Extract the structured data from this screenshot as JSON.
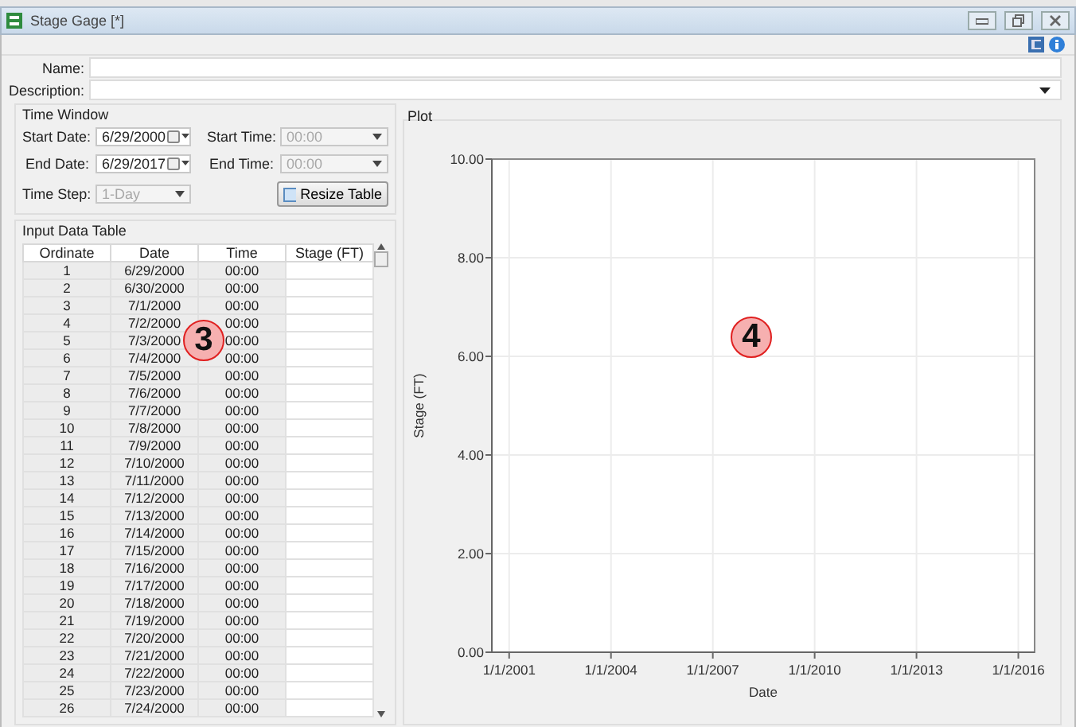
{
  "window": {
    "title": "Stage Gage [*]"
  },
  "fields": {
    "name": {
      "label": "Name:"
    },
    "description": {
      "label": "Description:"
    }
  },
  "time_window": {
    "title": "Time Window",
    "start_date": {
      "label": "Start Date:",
      "value": "6/29/2000"
    },
    "end_date": {
      "label": "End Date:",
      "value": "6/29/2017"
    },
    "time_step": {
      "label": "Time Step:",
      "value": "1-Day",
      "disabled": true
    },
    "start_time": {
      "label": "Start Time:",
      "value": "00:00",
      "disabled": true
    },
    "end_time": {
      "label": "End Time:",
      "value": "00:00",
      "disabled": true
    },
    "resize_button": {
      "label": "Resize Table"
    }
  },
  "table": {
    "title": "Input Data Table",
    "columns": [
      "Ordinate",
      "Date",
      "Time",
      "Stage (FT)"
    ],
    "rows": [
      [
        "1",
        "6/29/2000",
        "00:00"
      ],
      [
        "2",
        "6/30/2000",
        "00:00"
      ],
      [
        "3",
        "7/1/2000",
        "00:00"
      ],
      [
        "4",
        "7/2/2000",
        "00:00"
      ],
      [
        "5",
        "7/3/2000",
        "00:00"
      ],
      [
        "6",
        "7/4/2000",
        "00:00"
      ],
      [
        "7",
        "7/5/2000",
        "00:00"
      ],
      [
        "8",
        "7/6/2000",
        "00:00"
      ],
      [
        "9",
        "7/7/2000",
        "00:00"
      ],
      [
        "10",
        "7/8/2000",
        "00:00"
      ],
      [
        "11",
        "7/9/2000",
        "00:00"
      ],
      [
        "12",
        "7/10/2000",
        "00:00"
      ],
      [
        "13",
        "7/11/2000",
        "00:00"
      ],
      [
        "14",
        "7/12/2000",
        "00:00"
      ],
      [
        "15",
        "7/13/2000",
        "00:00"
      ],
      [
        "16",
        "7/14/2000",
        "00:00"
      ],
      [
        "17",
        "7/15/2000",
        "00:00"
      ],
      [
        "18",
        "7/16/2000",
        "00:00"
      ],
      [
        "19",
        "7/17/2000",
        "00:00"
      ],
      [
        "20",
        "7/18/2000",
        "00:00"
      ],
      [
        "21",
        "7/19/2000",
        "00:00"
      ],
      [
        "22",
        "7/20/2000",
        "00:00"
      ],
      [
        "23",
        "7/21/2000",
        "00:00"
      ],
      [
        "24",
        "7/22/2000",
        "00:00"
      ],
      [
        "25",
        "7/23/2000",
        "00:00"
      ],
      [
        "26",
        "7/24/2000",
        "00:00"
      ]
    ]
  },
  "plot": {
    "title": "Plot",
    "chart_data": {
      "type": "line",
      "grid": true,
      "xlabel": "Date",
      "ylabel": "Stage (FT)",
      "ylim": [
        0,
        10
      ],
      "categories": [
        "1/1/2001",
        "1/1/2004",
        "1/1/2007",
        "1/1/2010",
        "1/1/2013",
        "1/1/2016"
      ],
      "yticks": [
        {
          "value": 0,
          "label": "0.00"
        },
        {
          "value": 2,
          "label": "2.00"
        },
        {
          "value": 4,
          "label": "4.00"
        },
        {
          "value": 6,
          "label": "6.00"
        },
        {
          "value": 8,
          "label": "8.00"
        },
        {
          "value": 10,
          "label": "10.00"
        }
      ]
    }
  },
  "callouts": [
    {
      "label": "3"
    },
    {
      "label": "4"
    }
  ]
}
